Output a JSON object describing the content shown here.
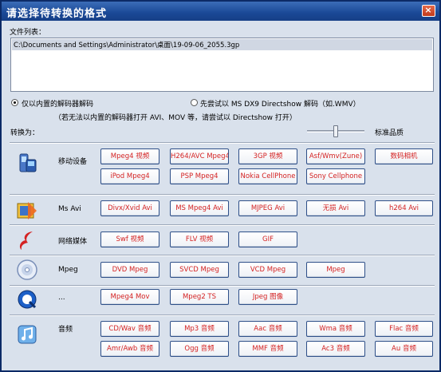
{
  "window": {
    "title": "请选择待转换的格式",
    "close_glyph": "×"
  },
  "filelist": {
    "label": "文件列表：",
    "files": [
      "C:\\Documents and Settings\\Administrator\\桌面\\19-09-06_2055.3gp"
    ]
  },
  "decoder_options": {
    "builtin_only": "仅以内置的解码器解码",
    "try_directshow": "先尝试以 MS DX9 Directshow 解码（如.WMV）",
    "hint": "（若无法以内置的解码器打开 AVI、MOV 等，请尝试以 Directshow 打开）",
    "selected": "builtin_only"
  },
  "convert_to": "转换为：",
  "quality": {
    "label": "标准品质",
    "level": 0.5
  },
  "categories": [
    {
      "name": "移动设备",
      "icon": "mobile-device-icon",
      "buttons": [
        "Mpeg4 视频",
        "H264/AVC Mpeg4",
        "3GP 视频",
        "Asf/Wmv(Zune)",
        "数码相机",
        "iPod Mpeg4",
        "PSP Mpeg4",
        "Nokia CellPhone",
        "Sony Cellphone"
      ]
    },
    {
      "name": "Ms Avi",
      "icon": "avi-film-icon",
      "buttons": [
        "Divx/Xvid Avi",
        "MS Mpeg4 Avi",
        "MJPEG Avi",
        "无损 Avi",
        "h264 Avi"
      ]
    },
    {
      "name": "网络媒体",
      "icon": "flash-icon",
      "buttons": [
        "Swf 视频",
        "FLV 视频",
        "GIF"
      ]
    },
    {
      "name": "Mpeg",
      "icon": "disc-icon",
      "buttons": [
        "DVD Mpeg",
        "SVCD Mpeg",
        "VCD Mpeg",
        "Mpeg"
      ]
    },
    {
      "name": "...",
      "icon": "quicktime-icon",
      "buttons": [
        "Mpeg4 Mov",
        "Mpeg2 TS",
        "Jpeg 图像"
      ]
    },
    {
      "name": "音频",
      "icon": "audio-icon",
      "buttons": [
        "CD/Wav 音频",
        "Mp3 音频",
        "Aac 音频",
        "Wma 音频",
        "Flac 音频",
        "Amr/Awb 音频",
        "Ogg 音频",
        "MMF 音频",
        "Ac3 音频",
        "Au 音频"
      ]
    }
  ],
  "colors": {
    "title_bar": "#1a4896",
    "background": "#d9e1ec",
    "button_text": "#d42222",
    "button_border": "#2e4f88"
  }
}
